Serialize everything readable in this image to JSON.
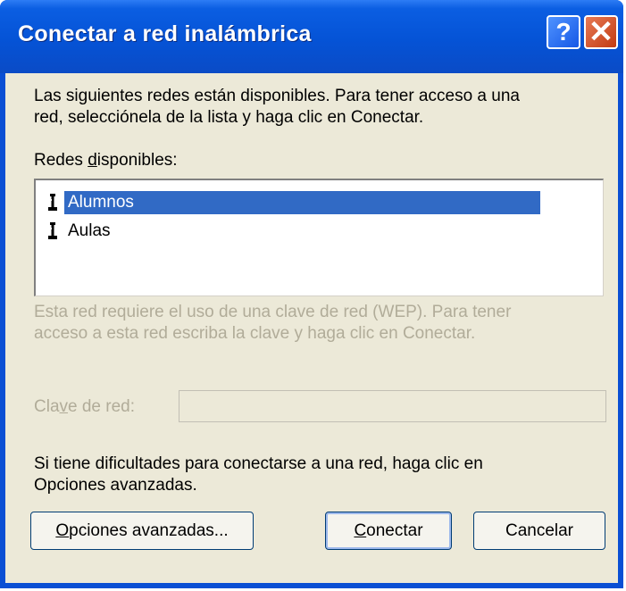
{
  "window": {
    "title": "Conectar a red inalámbrica"
  },
  "titlebar": {
    "help_label": "?",
    "close_label": "✕"
  },
  "intro": {
    "line1": "Las siguientes redes están disponibles. Para tener acceso a una",
    "line2": "red, selecciónela de la lista y haga clic en Conectar."
  },
  "networks": {
    "label_prefix": "Redes ",
    "label_mnemonic": "d",
    "label_rest": "isponibles:",
    "items": [
      {
        "label": "Alumnos",
        "selected": true,
        "icon": "wireless-network-icon"
      },
      {
        "label": "Aulas",
        "selected": false,
        "icon": "wireless-network-icon"
      }
    ]
  },
  "wep_notice": {
    "line1": "Esta red requiere el uso de una clave de red (WEP). Para tener",
    "line2": "acceso a esta red escriba la clave y haga clic en Conectar."
  },
  "key": {
    "label_prefix": "Cla",
    "label_mnemonic": "v",
    "label_rest": "e de red:",
    "value": ""
  },
  "help_text": {
    "line1": "Si tiene dificultades para conectarse a una red, haga clic en",
    "line2": "Opciones avanzadas."
  },
  "buttons": {
    "advanced_mnemonic": "O",
    "advanced_rest": "pciones avanzadas...",
    "connect_mnemonic": "C",
    "connect_rest": "onectar",
    "cancel": "Cancelar"
  },
  "colors": {
    "titlebar": "#0553d6",
    "dialog_bg": "#ece9d8",
    "selection": "#316ac5",
    "disabled_text": "#b1ac99",
    "close_button": "#c23b12"
  }
}
